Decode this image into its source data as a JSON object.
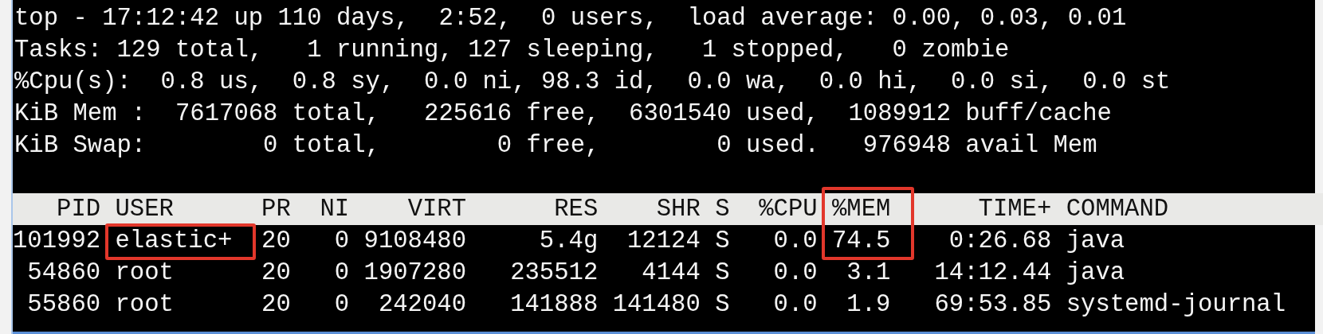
{
  "summary": [
    "top - 17:12:42 up 110 days,  2:52,  0 users,  load average: 0.00, 0.03, 0.01",
    "Tasks: 129 total,   1 running, 127 sleeping,   1 stopped,   0 zombie",
    "%Cpu(s):  0.8 us,  0.8 sy,  0.0 ni, 98.3 id,  0.0 wa,  0.0 hi,  0.0 si,  0.0 st",
    "KiB Mem :  7617068 total,   225616 free,  6301540 used,  1089912 buff/cache",
    "KiB Swap:        0 total,        0 free,        0 used.   976948 avail Mem"
  ],
  "table": {
    "columns": [
      {
        "label": "PID",
        "header_boxed": false,
        "first_row_boxed": false
      },
      {
        "label": "USER",
        "header_boxed": false,
        "first_row_boxed": true
      },
      {
        "label": "PR",
        "header_boxed": false,
        "first_row_boxed": false
      },
      {
        "label": "NI",
        "header_boxed": false,
        "first_row_boxed": false
      },
      {
        "label": "VIRT",
        "header_boxed": false,
        "first_row_boxed": false
      },
      {
        "label": "RES",
        "header_boxed": false,
        "first_row_boxed": false
      },
      {
        "label": "SHR",
        "header_boxed": false,
        "first_row_boxed": false
      },
      {
        "label": "S",
        "header_boxed": false,
        "first_row_boxed": false
      },
      {
        "label": "%CPU",
        "header_boxed": false,
        "first_row_boxed": false
      },
      {
        "label": "%MEM",
        "header_boxed": true,
        "first_row_boxed": true
      },
      {
        "label": "TIME+",
        "header_boxed": false,
        "first_row_boxed": false
      },
      {
        "label": "COMMAND",
        "header_boxed": false,
        "first_row_boxed": false
      }
    ],
    "rows": [
      [
        "101992",
        "elastic+",
        "20",
        "0",
        "9108480",
        "5.4g",
        "12124",
        "S",
        "0.0",
        "74.5",
        "0:26.68",
        "java"
      ],
      [
        "54860",
        "root",
        "20",
        "0",
        "1907280",
        "235512",
        "4144",
        "S",
        "0.0",
        "3.1",
        "14:12.44",
        "java"
      ],
      [
        "55860",
        "root",
        "20",
        "0",
        "242040",
        "141888",
        "141480",
        "S",
        "0.0",
        "1.9",
        "69:53.85",
        "systemd-journal"
      ]
    ]
  }
}
